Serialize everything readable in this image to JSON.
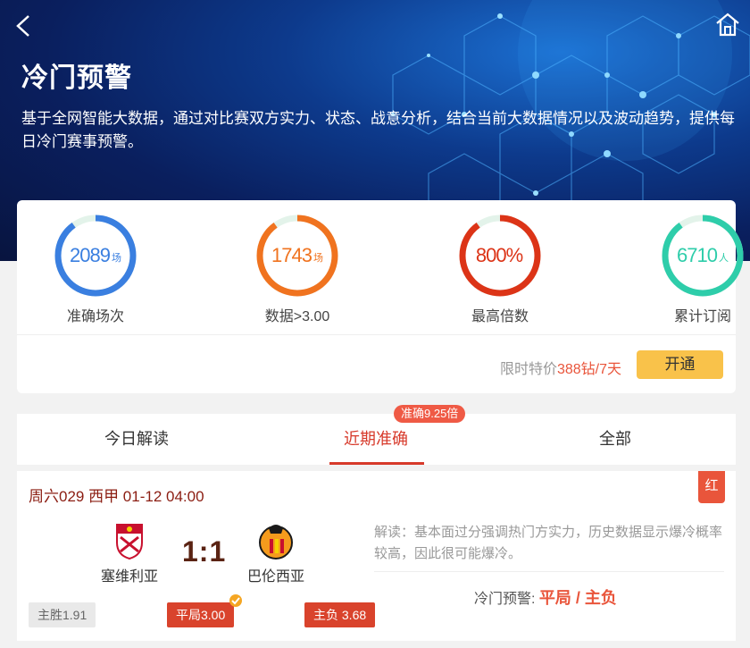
{
  "header": {
    "title": "冷门预警",
    "description": "基于全网智能大数据，通过对比赛双方实力、状态、战意分析，结合当前大数据情况以及波动趋势，提供每日冷门赛事预警。"
  },
  "stats": [
    {
      "value": "2089",
      "unit": "场",
      "label": "准确场次",
      "color": "#3a7fe0",
      "fill": 0.9
    },
    {
      "value": "1743",
      "unit": "场",
      "label": "数据>3.00",
      "color": "#f0731f",
      "fill": 0.9
    },
    {
      "value": "800%",
      "unit": "",
      "label": "最高倍数",
      "color": "#dc3417",
      "fill": 0.9
    },
    {
      "value": "6710",
      "unit": "人",
      "label": "累计订阅",
      "color": "#2ecdaa",
      "fill": 0.9
    }
  ],
  "promo": {
    "prefix": "限时特价",
    "price": "388钻/7天",
    "button": "开通"
  },
  "tabs": [
    {
      "label": "今日解读"
    },
    {
      "label": "近期准确"
    },
    {
      "label": "全部"
    }
  ],
  "tab_badge": "准确9.25倍",
  "match": {
    "header": "周六029 西甲 01-12 04:00",
    "result_tag": "红",
    "home": "塞维利亚",
    "away": "巴伦西亚",
    "score": "1:1",
    "analysis": "解读：基本面过分强调热门方实力，历史数据显示爆冷概率较高，因此很可能爆冷。",
    "warn_label": "冷门预警:",
    "warn_pick": "平局 / 主负",
    "odds": [
      {
        "label": "主胜1.91"
      },
      {
        "label": "平局3.00"
      },
      {
        "label": "主负 3.68"
      }
    ]
  }
}
